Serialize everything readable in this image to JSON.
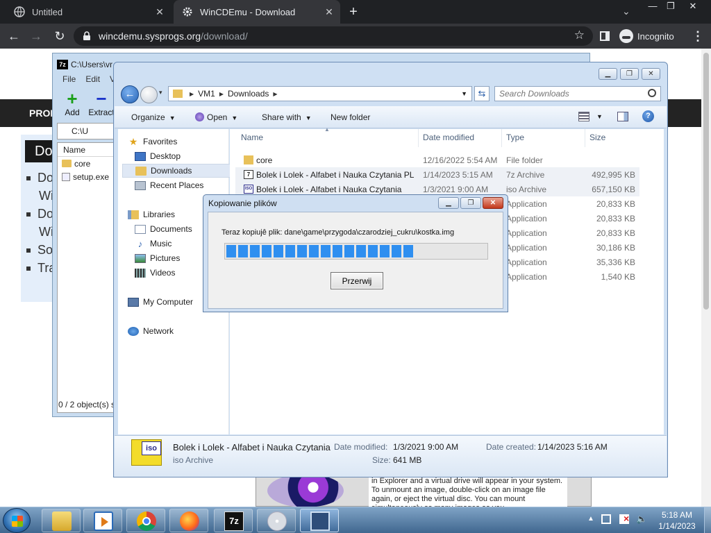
{
  "browser": {
    "tabs": [
      {
        "title": "Untitled",
        "active": false
      },
      {
        "title": "WinCDEmu - Download",
        "active": true
      }
    ],
    "url_host": "wincdemu.sysprogs.org",
    "url_path": "/download/",
    "incognito_label": "Incognito"
  },
  "webpage": {
    "nav_text": "PROD",
    "download_heading": "Dov",
    "bullets": [
      "Do",
      "Wi",
      "Do",
      "Wi",
      "So",
      "Tra"
    ],
    "card_text": "in Explorer and a virtual drive will appear in your system. To unmount an image, double-click on an image file again, or eject the virtual disc. You can mount simultaneously as many images as you"
  },
  "zip": {
    "title": "C:\\Users\\vr",
    "menu": [
      "File",
      "Edit",
      "V"
    ],
    "add_label": "Add",
    "extract_label": "Extract",
    "address": "C:\\U",
    "col_name": "Name",
    "items": [
      "core",
      "setup.exe"
    ],
    "status": "0 / 2 object(s) s"
  },
  "explorer": {
    "breadcrumb": [
      "VM1",
      "Downloads"
    ],
    "search_placeholder": "Search Downloads",
    "commands": {
      "organize": "Organize",
      "open": "Open",
      "share": "Share with",
      "new_folder": "New folder"
    },
    "nav": {
      "favorites": "Favorites",
      "desktop": "Desktop",
      "downloads": "Downloads",
      "recent": "Recent Places",
      "libraries": "Libraries",
      "documents": "Documents",
      "music": "Music",
      "pictures": "Pictures",
      "videos": "Videos",
      "computer": "My Computer",
      "network": "Network"
    },
    "columns": {
      "name": "Name",
      "date": "Date modified",
      "type": "Type",
      "size": "Size"
    },
    "files": [
      {
        "name": "core",
        "date": "12/16/2022 5:54 AM",
        "type": "File folder",
        "size": "",
        "icon": "folder-icon"
      },
      {
        "name": "Bolek i Lolek - Alfabet i Nauka Czytania PL",
        "date": "1/14/2023 5:15 AM",
        "type": "7z Archive",
        "size": "492,995 KB",
        "icon": "7z-file-icon"
      },
      {
        "name": "Bolek i Lolek - Alfabet i Nauka Czytania",
        "date": "1/3/2021 9:00 AM",
        "type": "iso Archive",
        "size": "657,150 KB",
        "icon": "iso-file-icon"
      },
      {
        "name": "",
        "date": "",
        "type": "Application",
        "size": "20,833 KB",
        "icon": ""
      },
      {
        "name": "",
        "date": "",
        "type": "Application",
        "size": "20,833 KB",
        "icon": ""
      },
      {
        "name": "",
        "date": "",
        "type": "Application",
        "size": "20,833 KB",
        "icon": ""
      },
      {
        "name": "",
        "date": "",
        "type": "Application",
        "size": "30,186 KB",
        "icon": ""
      },
      {
        "name": "",
        "date": "",
        "type": "Application",
        "size": "35,336 KB",
        "icon": ""
      },
      {
        "name": "",
        "date": "",
        "type": "Application",
        "size": "1,540 KB",
        "icon": ""
      }
    ],
    "details": {
      "name": "Bolek i Lolek - Alfabet i Nauka Czytania",
      "type": "iso Archive",
      "date_modified_label": "Date modified:",
      "date_modified": "1/3/2021 9:00 AM",
      "date_created_label": "Date created:",
      "date_created": "1/14/2023 5:16 AM",
      "size_label": "Size:",
      "size": "641 MB"
    }
  },
  "copy_dialog": {
    "title": "Kopiowanie plików",
    "message": "Teraz kopiujê plik: dane\\game\\przygoda\\czarodziej_cukru\\kostka.img",
    "progress": 0.72,
    "stop_label": "Przerwij",
    "bar_color": "#2f8ff0"
  },
  "taskbar": {
    "apps": [
      "folder-icon",
      "media-player-icon",
      "chrome-icon",
      "firefox-icon",
      "7zip-icon",
      "disc-icon",
      "monitor-icon"
    ],
    "seven_zip_glyph": "7z",
    "time": "5:18 AM",
    "date": "1/14/2023"
  }
}
